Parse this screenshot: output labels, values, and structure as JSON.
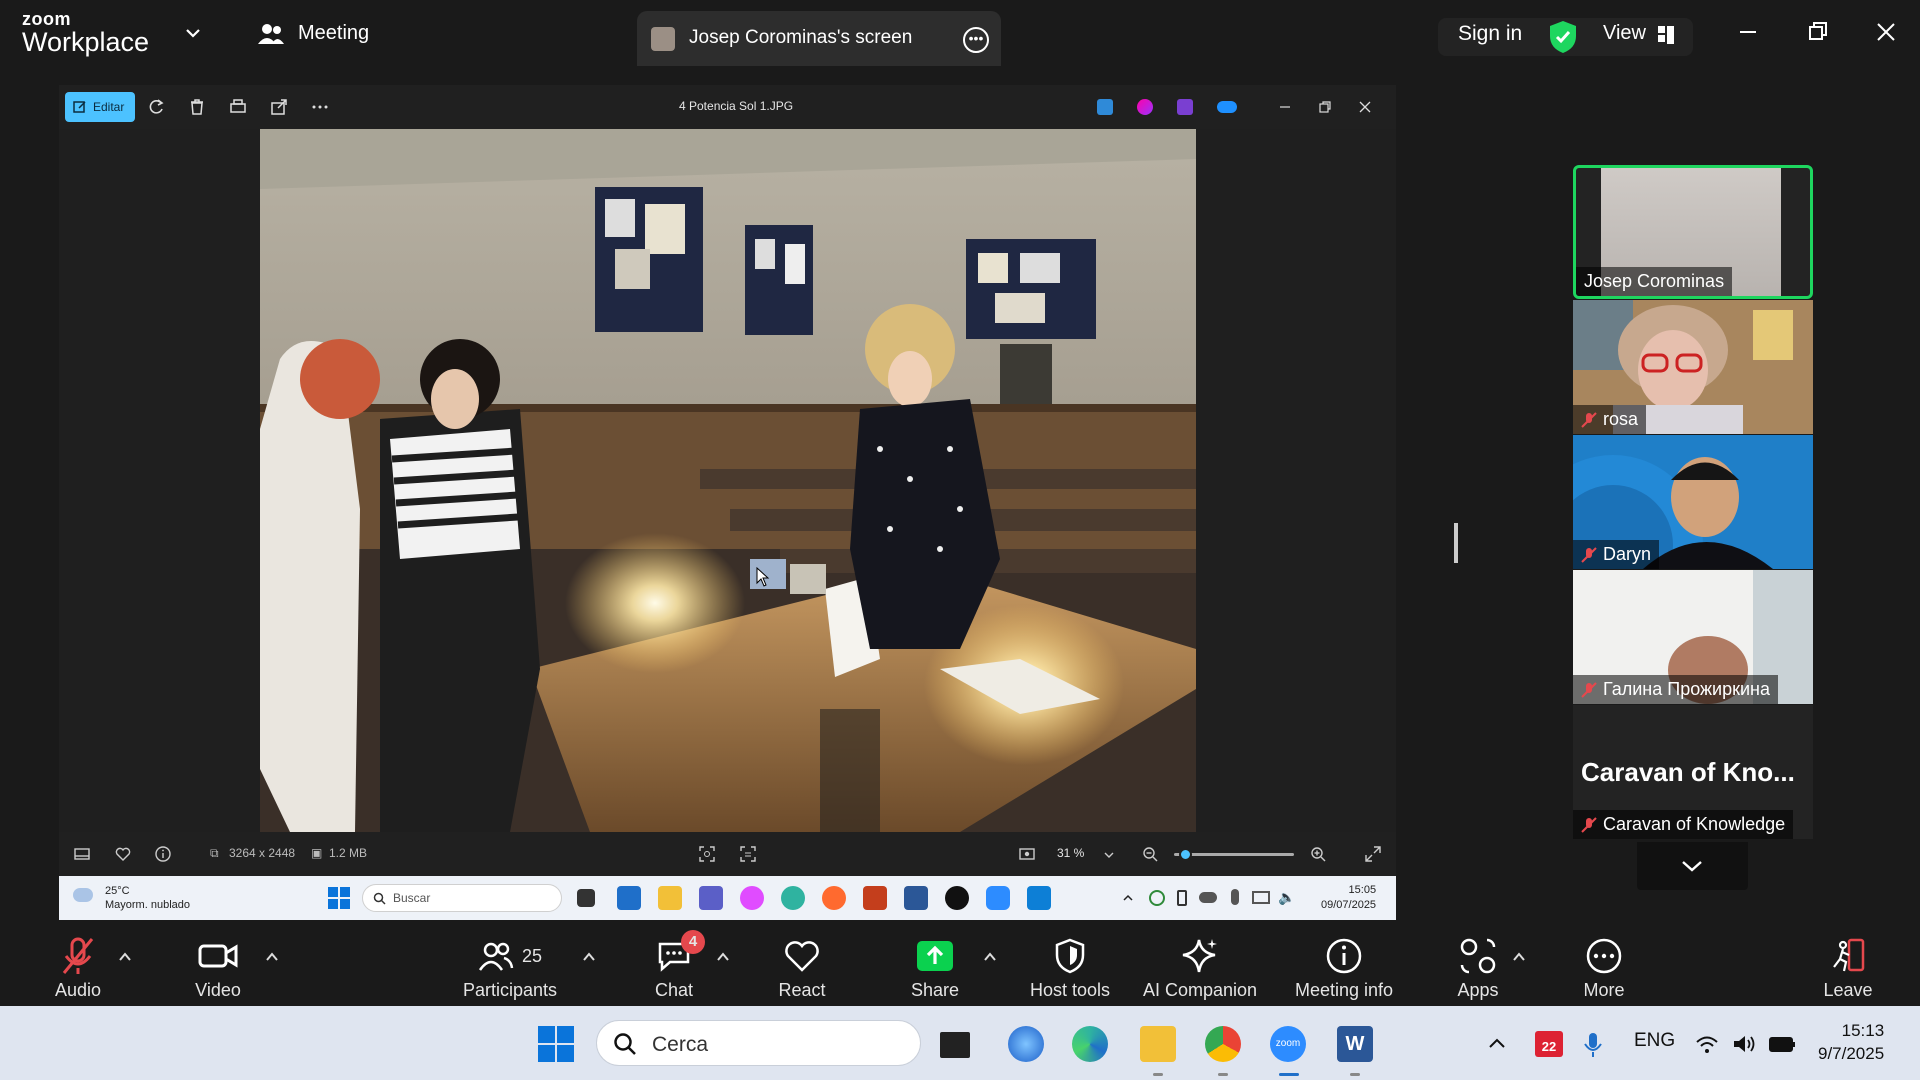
{
  "titlebar": {
    "logo_line1": "zoom",
    "logo_line2": "Workplace",
    "meeting_label": "Meeting",
    "share_tab_label": "Josep Corominas's screen",
    "signin_label": "Sign in",
    "view_label": "View"
  },
  "photos_app": {
    "edit_label": "Editar",
    "file_title": "4 Potencia Sol 1.JPG",
    "dimensions": "3264 x 2448",
    "file_size": "1.2 MB",
    "zoom_level": "31 %",
    "zoom_slider_fraction": 0.05
  },
  "inner_taskbar": {
    "temperature": "25°C",
    "weather": "Mayorm. nublado",
    "search_placeholder": "Buscar",
    "time": "15:05",
    "date": "09/07/2025"
  },
  "participants": [
    {
      "name": "Josep Corominas",
      "muted": false,
      "active_speaker": true
    },
    {
      "name": "rosa",
      "muted": true
    },
    {
      "name": "Daryn",
      "muted": true
    },
    {
      "name": "Галина Прожиркина",
      "muted": true
    },
    {
      "name": "Caravan of Knowledge",
      "display_title": "Caravan of Kno...",
      "muted": true
    }
  ],
  "meeting_toolbar": {
    "audio": "Audio",
    "video": "Video",
    "participants": "Participants",
    "participants_count": "25",
    "chat": "Chat",
    "chat_badge": "4",
    "react": "React",
    "share": "Share",
    "host_tools": "Host tools",
    "ai_companion": "AI Companion",
    "meeting_info": "Meeting info",
    "apps": "Apps",
    "more": "More",
    "leave": "Leave"
  },
  "windows_taskbar": {
    "search_placeholder": "Cerca",
    "calendar_badge": "22",
    "language": "ENG",
    "time": "15:13",
    "date": "9/7/2025"
  },
  "colors": {
    "zoom_green": "#1ed65f",
    "share_green": "#0bd14f",
    "leave_red": "#e5484d",
    "photos_accent": "#4cc2ff"
  }
}
